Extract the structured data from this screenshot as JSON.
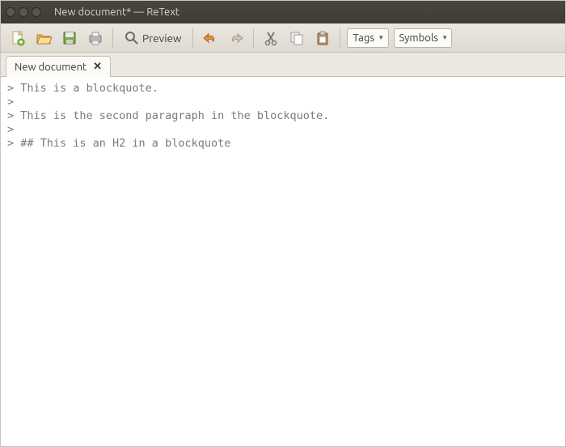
{
  "window": {
    "title": "New document* — ReText"
  },
  "toolbar": {
    "preview_label": "Preview",
    "dropdown1": "Tags",
    "dropdown2": "Symbols"
  },
  "tabs": [
    {
      "label": "New document"
    }
  ],
  "editor": {
    "lines": [
      "> This is a blockquote.",
      ">",
      "> This is the second paragraph in the blockquote.",
      ">",
      "> ## This is an H2 in a blockquote"
    ]
  }
}
